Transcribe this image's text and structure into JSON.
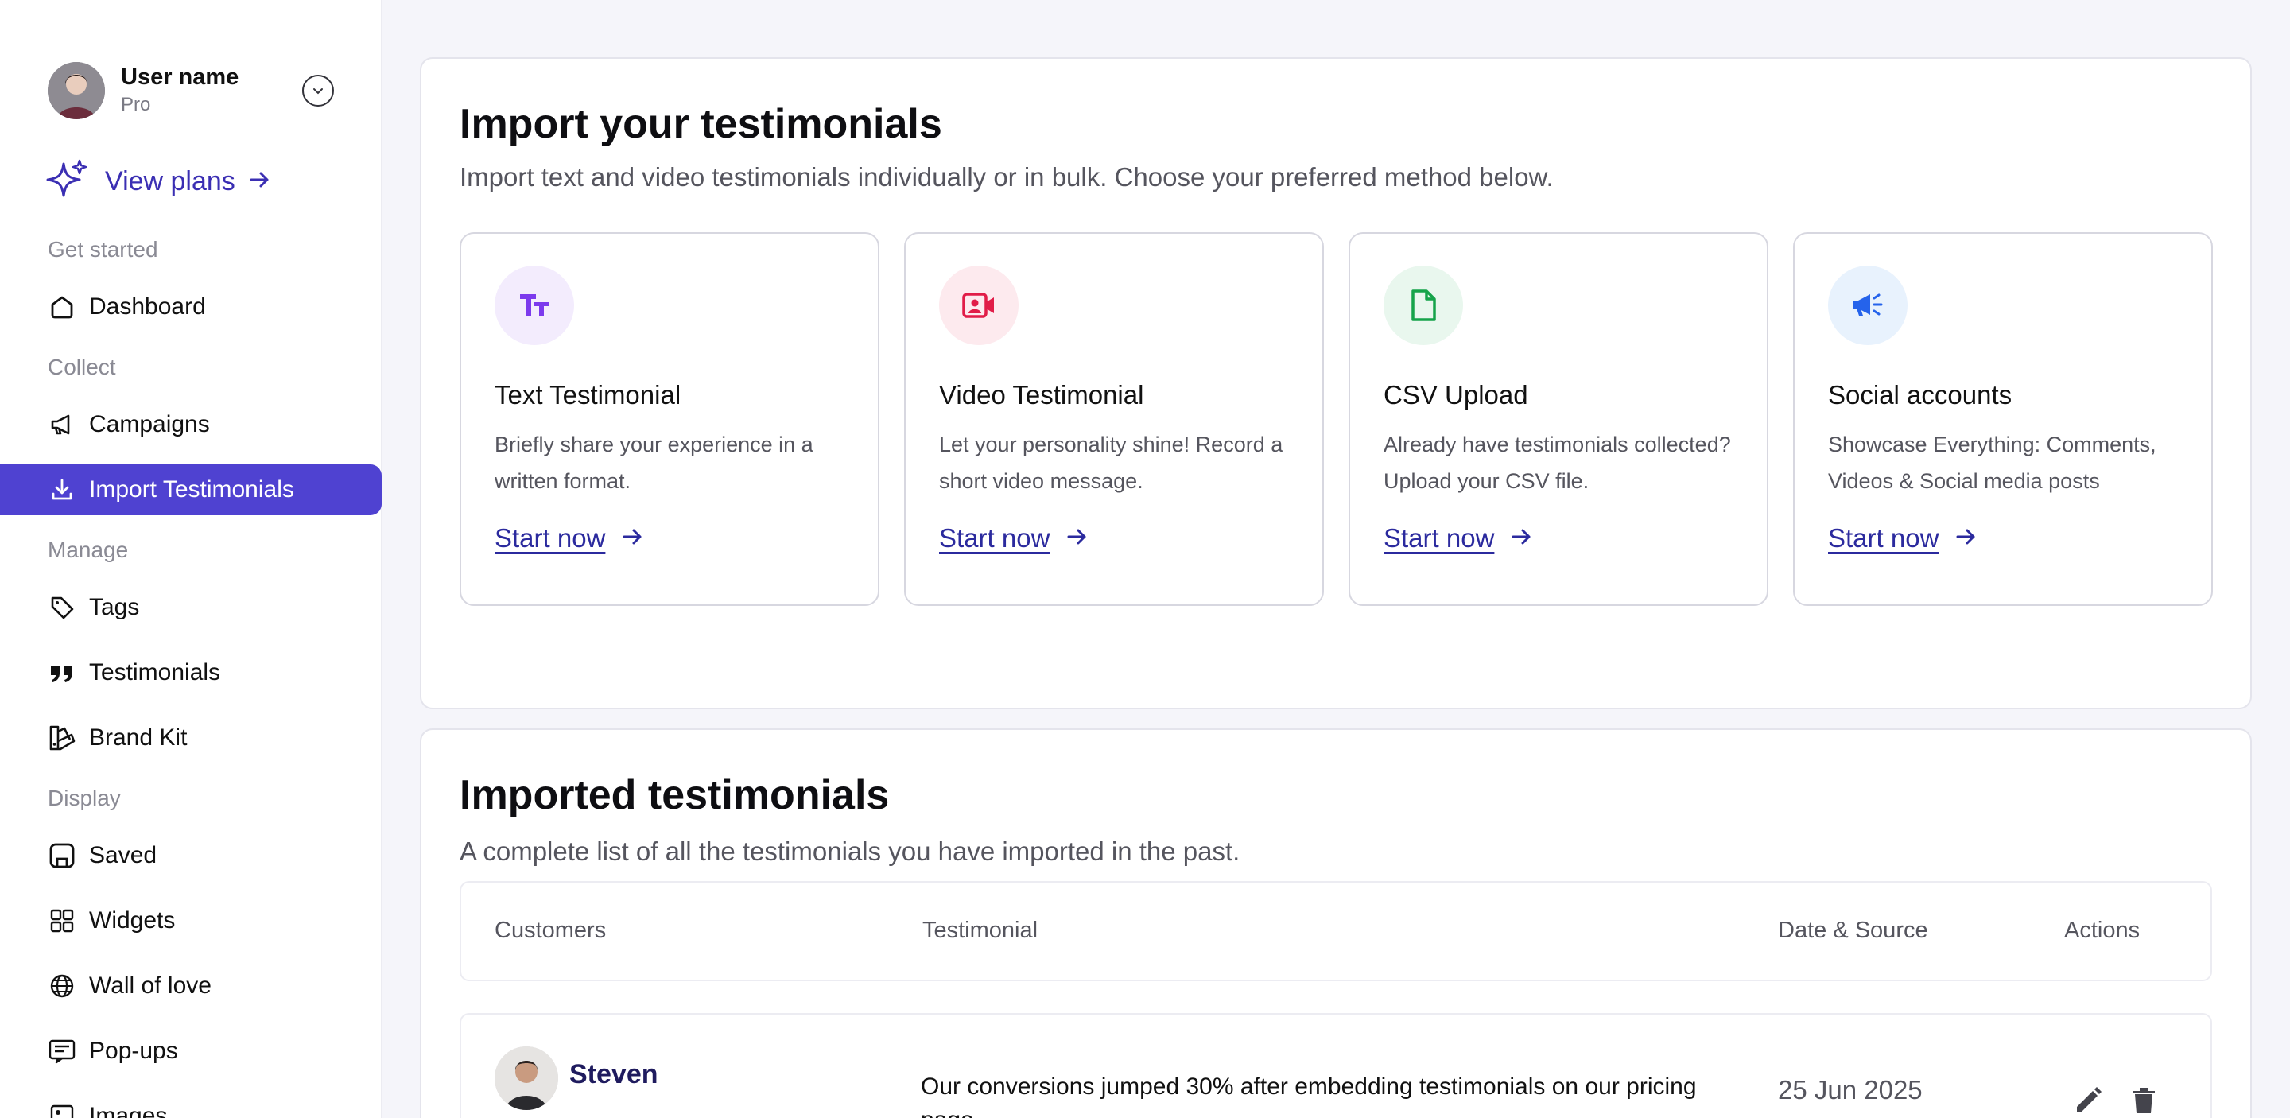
{
  "user": {
    "name": "User name",
    "plan": "Pro"
  },
  "view_plans": {
    "label": "View plans"
  },
  "nav": {
    "sections": {
      "get_started": "Get started",
      "collect": "Collect",
      "manage": "Manage",
      "display": "Display"
    },
    "items": {
      "dashboard": "Dashboard",
      "campaigns": "Campaigns",
      "import_testimonials": "Import Testimonials",
      "tags": "Tags",
      "testimonials": "Testimonials",
      "brand_kit": "Brand Kit",
      "saved": "Saved",
      "widgets": "Widgets",
      "wall_of_love": "Wall of love",
      "pop_ups": "Pop-ups",
      "images": "Images"
    },
    "active": "import_testimonials"
  },
  "import_panel": {
    "title": "Import your testimonials",
    "subtitle": "Import text and video testimonials individually or in bulk. Choose your preferred method below.",
    "cards": [
      {
        "icon": "text-format-icon",
        "title": "Text Testimonial",
        "description": "Briefly share your experience in a written format.",
        "cta": "Start now",
        "icon_bg": "#f3ecfd",
        "icon_color": "#7c3aed"
      },
      {
        "icon": "video-contact-icon",
        "title": "Video Testimonial",
        "description": "Let your personality shine! Record a short video message.",
        "cta": "Start now",
        "icon_bg": "#fdeaee",
        "icon_color": "#e11d48"
      },
      {
        "icon": "file-icon",
        "title": "CSV Upload",
        "description": "Already have testimonials collected? Upload your CSV file.",
        "cta": "Start now",
        "icon_bg": "#e9f7ee",
        "icon_color": "#16a34a"
      },
      {
        "icon": "megaphone-icon",
        "title": "Social accounts",
        "description": "Showcase Everything: Comments, Videos & Social media posts",
        "cta": "Start now",
        "icon_bg": "#e8f2fd",
        "icon_color": "#2563eb"
      }
    ]
  },
  "list_panel": {
    "title": "Imported testimonials",
    "subtitle": "A complete list of all the testimonials you have imported in the past.",
    "columns": [
      "Customers",
      "Testimonial",
      "Date & Source",
      "Actions"
    ],
    "rows": [
      {
        "customer": "Steven",
        "testimonial": "Our conversions jumped 30% after embedding testimonials on our pricing page.",
        "date": "25 Jun 2025"
      }
    ]
  },
  "colors": {
    "accent": "#4f42d1",
    "link": "#2b2a9e"
  }
}
